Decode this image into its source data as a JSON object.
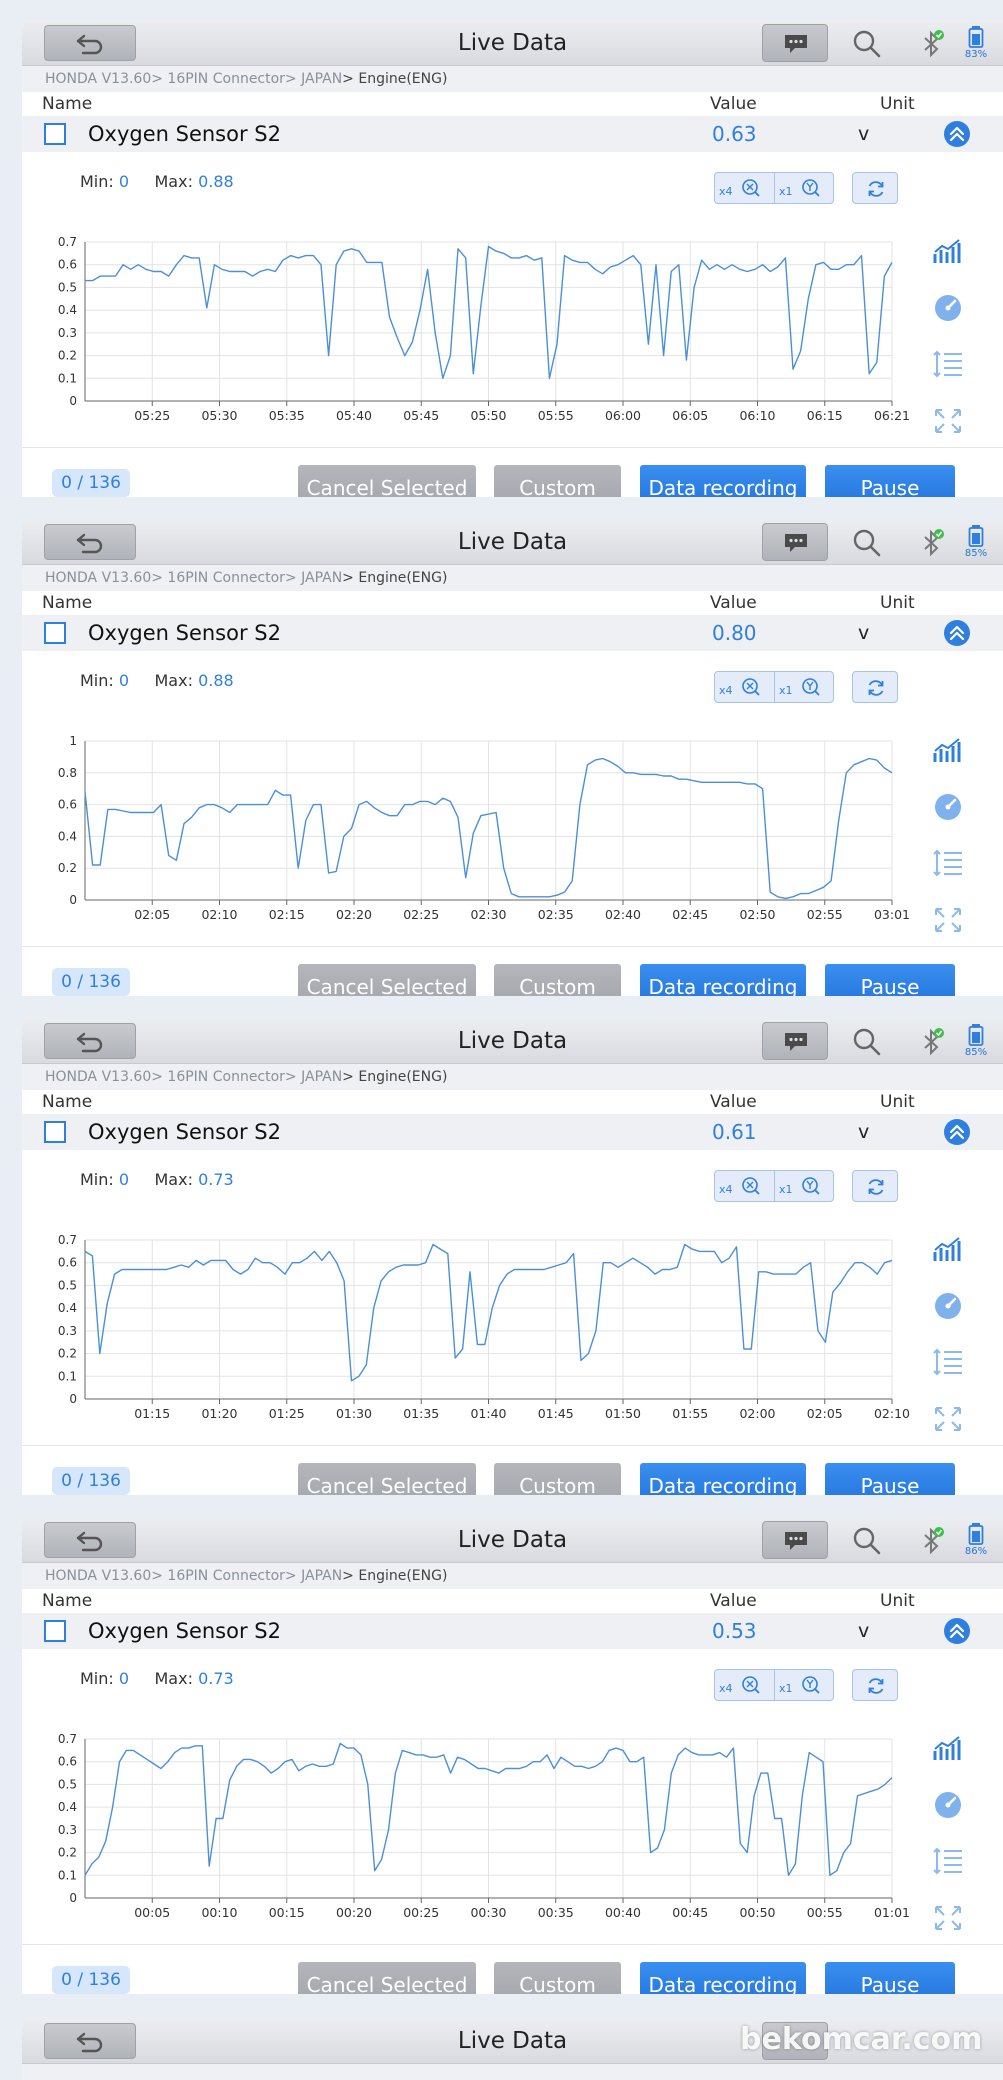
{
  "header": {
    "title": "Live Data"
  },
  "breadcrumb": {
    "prefix": "HONDA V13.60> 16PIN Connector> JAPAN",
    "suffix": "> Engine(ENG)"
  },
  "columns": {
    "name": "Name",
    "value": "Value",
    "unit": "Unit"
  },
  "labels": {
    "min": "Min:",
    "max": "Max:",
    "x4": "x4",
    "x1": "x1"
  },
  "footer": {
    "cancel_selected": "Cancel Selected",
    "custom": "Custom",
    "data_recording": "Data recording",
    "pause": "Pause"
  },
  "colors": {
    "accent": "#2f7fe0",
    "line": "#4a90d9",
    "grid": "#e3e3e3"
  },
  "icons": [
    "back-arrow-icon",
    "message-icon",
    "search-icon",
    "bluetooth-icon",
    "battery-icon",
    "collapse-up-icon",
    "zoom-x-icon",
    "zoom-y-icon",
    "refresh-icon",
    "trend-chart-icon",
    "gauge-icon",
    "list-icon",
    "fullscreen-icon"
  ],
  "panels": [
    {
      "battery": "83%",
      "sensor": {
        "name": "Oxygen Sensor S2",
        "value": "0.63",
        "unit": "v"
      },
      "min": "0",
      "max": "0.88",
      "counter": "0 / 136",
      "chart_data": {
        "type": "line",
        "ylim": [
          0,
          0.7
        ],
        "yticks": [
          "0",
          "0.1",
          "0.2",
          "0.3",
          "0.4",
          "0.5",
          "0.6",
          "0.7"
        ],
        "xticks": [
          "05:25",
          "05:30",
          "05:35",
          "05:40",
          "05:45",
          "05:50",
          "05:55",
          "06:00",
          "06:05",
          "06:10",
          "06:15",
          "06:21"
        ],
        "x_start": "05:21",
        "x_end": "06:21",
        "values": [
          0.53,
          0.53,
          0.55,
          0.55,
          0.55,
          0.6,
          0.58,
          0.6,
          0.58,
          0.57,
          0.57,
          0.55,
          0.6,
          0.64,
          0.63,
          0.63,
          0.41,
          0.6,
          0.58,
          0.57,
          0.57,
          0.57,
          0.55,
          0.57,
          0.58,
          0.57,
          0.62,
          0.64,
          0.63,
          0.64,
          0.64,
          0.6,
          0.2,
          0.6,
          0.66,
          0.67,
          0.66,
          0.61,
          0.61,
          0.61,
          0.37,
          0.28,
          0.2,
          0.26,
          0.4,
          0.58,
          0.3,
          0.1,
          0.2,
          0.67,
          0.63,
          0.12,
          0.42,
          0.68,
          0.66,
          0.65,
          0.63,
          0.63,
          0.64,
          0.62,
          0.63,
          0.1,
          0.25,
          0.64,
          0.62,
          0.61,
          0.61,
          0.58,
          0.56,
          0.59,
          0.6,
          0.62,
          0.64,
          0.6,
          0.25,
          0.6,
          0.2,
          0.57,
          0.6,
          0.18,
          0.5,
          0.62,
          0.58,
          0.6,
          0.58,
          0.6,
          0.58,
          0.57,
          0.58,
          0.6,
          0.57,
          0.59,
          0.63,
          0.14,
          0.22,
          0.45,
          0.6,
          0.61,
          0.58,
          0.58,
          0.6,
          0.6,
          0.64,
          0.12,
          0.17,
          0.55,
          0.61
        ]
      }
    },
    {
      "battery": "85%",
      "sensor": {
        "name": "Oxygen Sensor S2",
        "value": "0.80",
        "unit": "v"
      },
      "min": "0",
      "max": "0.88",
      "counter": "0 / 136",
      "chart_data": {
        "type": "line",
        "ylim": [
          0,
          1
        ],
        "yticks": [
          "0",
          "0.2",
          "0.4",
          "0.6",
          "0.8",
          "1"
        ],
        "xticks": [
          "02:05",
          "02:10",
          "02:15",
          "02:20",
          "02:25",
          "02:30",
          "02:35",
          "02:40",
          "02:45",
          "02:50",
          "02:55",
          "03:01"
        ],
        "x_start": "02:01",
        "x_end": "03:01",
        "values": [
          0.68,
          0.22,
          0.22,
          0.57,
          0.57,
          0.56,
          0.55,
          0.55,
          0.55,
          0.55,
          0.6,
          0.28,
          0.25,
          0.48,
          0.52,
          0.58,
          0.6,
          0.6,
          0.58,
          0.55,
          0.6,
          0.6,
          0.6,
          0.6,
          0.6,
          0.69,
          0.66,
          0.66,
          0.2,
          0.5,
          0.6,
          0.6,
          0.17,
          0.18,
          0.4,
          0.45,
          0.6,
          0.62,
          0.58,
          0.55,
          0.53,
          0.53,
          0.6,
          0.6,
          0.62,
          0.62,
          0.6,
          0.64,
          0.62,
          0.52,
          0.14,
          0.42,
          0.53,
          0.54,
          0.55,
          0.2,
          0.04,
          0.02,
          0.02,
          0.02,
          0.02,
          0.02,
          0.03,
          0.05,
          0.12,
          0.6,
          0.85,
          0.88,
          0.89,
          0.87,
          0.84,
          0.8,
          0.8,
          0.79,
          0.79,
          0.79,
          0.78,
          0.78,
          0.76,
          0.76,
          0.75,
          0.74,
          0.74,
          0.74,
          0.74,
          0.74,
          0.74,
          0.73,
          0.73,
          0.7,
          0.05,
          0.02,
          0.01,
          0.02,
          0.04,
          0.04,
          0.06,
          0.08,
          0.12,
          0.5,
          0.8,
          0.85,
          0.87,
          0.89,
          0.88,
          0.83,
          0.8
        ]
      }
    },
    {
      "battery": "85%",
      "sensor": {
        "name": "Oxygen Sensor S2",
        "value": "0.61",
        "unit": "v"
      },
      "min": "0",
      "max": "0.73",
      "counter": "0 / 136",
      "chart_data": {
        "type": "line",
        "ylim": [
          0,
          0.7
        ],
        "yticks": [
          "0",
          "0.1",
          "0.2",
          "0.3",
          "0.4",
          "0.5",
          "0.6",
          "0.7"
        ],
        "xticks": [
          "01:15",
          "01:20",
          "01:25",
          "01:30",
          "01:35",
          "01:40",
          "01:45",
          "01:50",
          "01:55",
          "02:00",
          "02:05",
          "02:10"
        ],
        "x_start": "01:12",
        "x_end": "02:12",
        "values": [
          0.65,
          0.63,
          0.2,
          0.42,
          0.55,
          0.57,
          0.57,
          0.57,
          0.57,
          0.57,
          0.57,
          0.57,
          0.58,
          0.59,
          0.58,
          0.61,
          0.59,
          0.61,
          0.61,
          0.61,
          0.57,
          0.55,
          0.57,
          0.62,
          0.6,
          0.6,
          0.58,
          0.55,
          0.6,
          0.6,
          0.62,
          0.65,
          0.61,
          0.65,
          0.6,
          0.52,
          0.08,
          0.1,
          0.15,
          0.4,
          0.52,
          0.56,
          0.58,
          0.59,
          0.59,
          0.59,
          0.6,
          0.68,
          0.66,
          0.64,
          0.18,
          0.22,
          0.56,
          0.24,
          0.24,
          0.4,
          0.5,
          0.55,
          0.57,
          0.57,
          0.57,
          0.57,
          0.57,
          0.58,
          0.59,
          0.6,
          0.64,
          0.17,
          0.2,
          0.3,
          0.6,
          0.6,
          0.58,
          0.6,
          0.62,
          0.6,
          0.58,
          0.55,
          0.57,
          0.57,
          0.58,
          0.68,
          0.66,
          0.65,
          0.65,
          0.65,
          0.6,
          0.62,
          0.67,
          0.22,
          0.22,
          0.56,
          0.56,
          0.55,
          0.55,
          0.55,
          0.55,
          0.58,
          0.6,
          0.3,
          0.25,
          0.47,
          0.51,
          0.56,
          0.6,
          0.6,
          0.58,
          0.55,
          0.6,
          0.61
        ]
      }
    },
    {
      "battery": "86%",
      "sensor": {
        "name": "Oxygen Sensor S2",
        "value": "0.53",
        "unit": "v"
      },
      "min": "0",
      "max": "0.73",
      "counter": "0 / 136",
      "chart_data": {
        "type": "line",
        "ylim": [
          0,
          0.7
        ],
        "yticks": [
          "0",
          "0.1",
          "0.2",
          "0.3",
          "0.4",
          "0.5",
          "0.6",
          "0.7"
        ],
        "xticks": [
          "00:05",
          "00:10",
          "00:15",
          "00:20",
          "00:25",
          "00:30",
          "00:35",
          "00:40",
          "00:45",
          "00:50",
          "00:55",
          "01:01"
        ],
        "x_start": "00:01",
        "x_end": "01:01",
        "values": [
          0.1,
          0.15,
          0.18,
          0.25,
          0.4,
          0.6,
          0.65,
          0.65,
          0.63,
          0.61,
          0.59,
          0.57,
          0.6,
          0.64,
          0.66,
          0.66,
          0.67,
          0.67,
          0.14,
          0.35,
          0.35,
          0.52,
          0.58,
          0.61,
          0.61,
          0.6,
          0.58,
          0.55,
          0.57,
          0.6,
          0.61,
          0.56,
          0.58,
          0.59,
          0.58,
          0.58,
          0.59,
          0.68,
          0.66,
          0.66,
          0.63,
          0.5,
          0.12,
          0.17,
          0.3,
          0.55,
          0.65,
          0.64,
          0.63,
          0.63,
          0.62,
          0.62,
          0.63,
          0.55,
          0.62,
          0.61,
          0.59,
          0.57,
          0.57,
          0.56,
          0.55,
          0.57,
          0.57,
          0.57,
          0.58,
          0.6,
          0.6,
          0.63,
          0.57,
          0.62,
          0.6,
          0.58,
          0.58,
          0.57,
          0.58,
          0.6,
          0.65,
          0.66,
          0.65,
          0.6,
          0.6,
          0.62,
          0.2,
          0.22,
          0.3,
          0.55,
          0.63,
          0.66,
          0.64,
          0.63,
          0.63,
          0.63,
          0.64,
          0.62,
          0.66,
          0.24,
          0.2,
          0.45,
          0.55,
          0.55,
          0.35,
          0.35,
          0.1,
          0.15,
          0.45,
          0.64,
          0.62,
          0.6,
          0.1,
          0.12,
          0.2,
          0.24,
          0.45,
          0.46,
          0.47,
          0.48,
          0.5,
          0.53
        ]
      }
    }
  ],
  "partial_panel": {
    "title": "Live Data"
  },
  "watermark": "bekomcar.com"
}
